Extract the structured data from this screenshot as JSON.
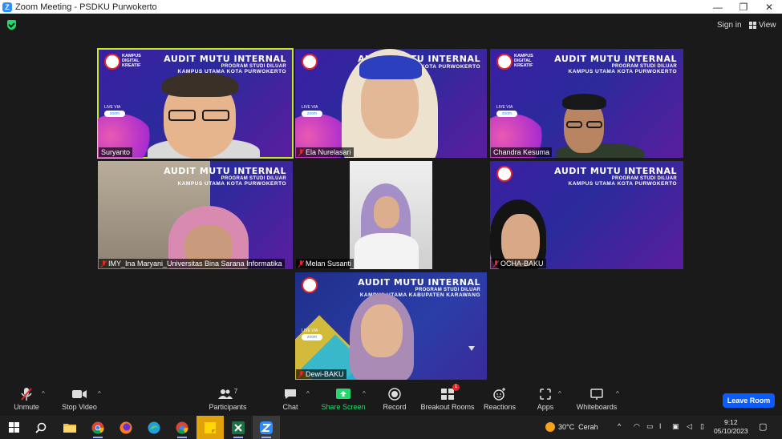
{
  "window": {
    "title": "Zoom Meeting - PSDKU Purwokerto",
    "minimize": "—",
    "restore": "❐",
    "close": "✕"
  },
  "topbar": {
    "signin": "Sign in",
    "view": "View"
  },
  "banner": {
    "title": "AUDIT MUTU INTERNAL",
    "subtitle": "PROGRAM STUDI DILUAR",
    "location": "KAMPUS UTAMA KOTA PURWOKERTO",
    "location_karawang": "KAMPUS UTAMA KABUPATEN KARAWANG",
    "kampus": "KAMPUS DIGITAL KREATIF",
    "live": "LIVE VIA",
    "zoom": "zoom"
  },
  "participants": [
    {
      "name": "Suryanto",
      "muted": false,
      "active": true
    },
    {
      "name": "Ela Nurelasari",
      "muted": true
    },
    {
      "name": "Chandra Kesuma",
      "muted": false
    },
    {
      "name": "IMY_Ina Maryani_Universitas Bina Sarana Informatika",
      "muted": true
    },
    {
      "name": "Melan Susanti",
      "muted": true
    },
    {
      "name": "OCHA-BAKU",
      "muted": true
    },
    {
      "name": "Dewi-BAKU",
      "muted": true
    }
  ],
  "toolbar": {
    "unmute": "Unmute",
    "stop_video": "Stop Video",
    "participants": "Participants",
    "participants_count": "7",
    "chat": "Chat",
    "share_screen": "Share Screen",
    "record": "Record",
    "breakout_rooms": "Breakout Rooms",
    "breakout_badge": "1",
    "reactions": "Reactions",
    "apps": "Apps",
    "whiteboards": "Whiteboards",
    "leave": "Leave Room"
  },
  "taskbar": {
    "weather": "30°C  Cerah",
    "time": "9:12",
    "date": "05/10/2023"
  },
  "colors": {
    "accent": "#0b5cff",
    "share": "#23d96e",
    "active_border": "#c8e82b",
    "mute": "#e02828"
  }
}
